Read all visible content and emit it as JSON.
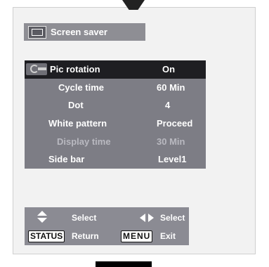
{
  "header": {
    "title": "Screen saver",
    "icon": "screen-saver-icon"
  },
  "menu": {
    "rows": [
      {
        "label": "Pic rotation",
        "value": "On",
        "state": "selected"
      },
      {
        "label": "Cycle time",
        "value": "60 Min",
        "state": "normal"
      },
      {
        "label": "Dot",
        "value": "4",
        "state": "normal"
      },
      {
        "label": "White pattern",
        "value": "Proceed",
        "state": "normal"
      },
      {
        "label": "Display time",
        "value": "30 Min",
        "state": "disabled"
      },
      {
        "label": "Side bar",
        "value": "Level1",
        "state": "normal"
      }
    ]
  },
  "guide": {
    "select_updown": "Select",
    "select_leftright": "Select",
    "status_key": "STATUS",
    "return_label": "Return",
    "menu_key": "MENU",
    "exit_label": "Exit"
  }
}
